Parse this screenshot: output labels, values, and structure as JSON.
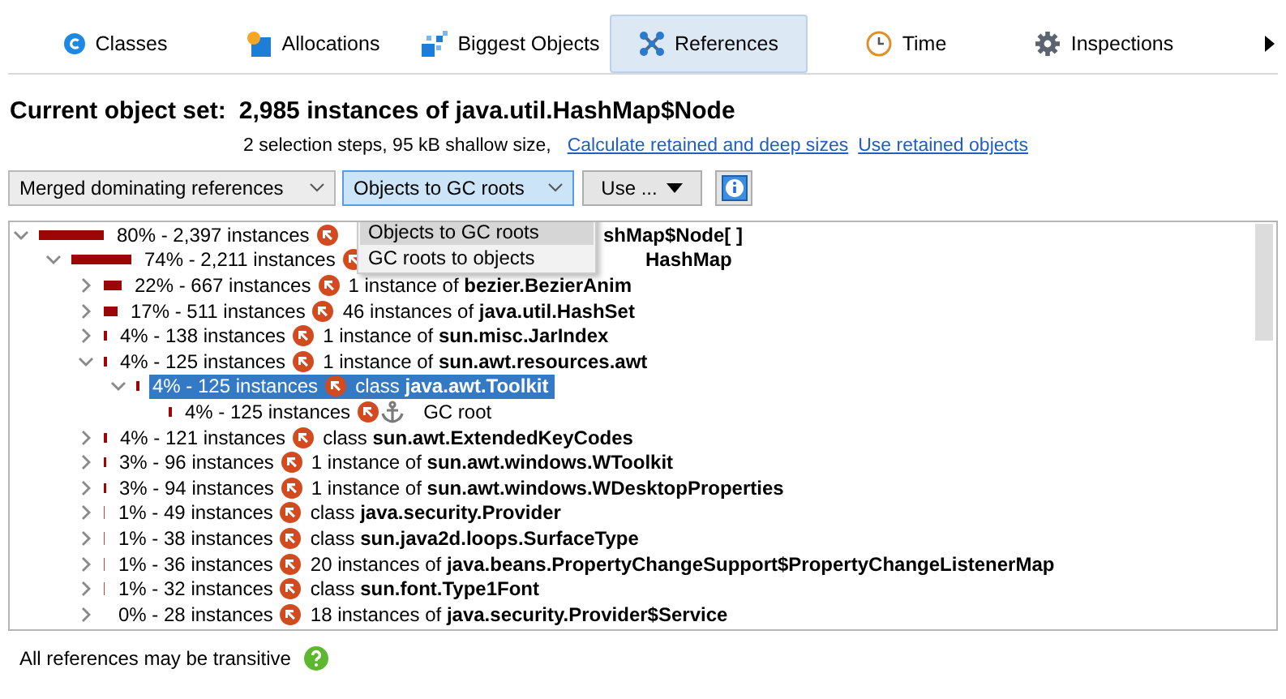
{
  "tabs": [
    {
      "label": "Classes",
      "selected": false
    },
    {
      "label": "Allocations",
      "selected": false
    },
    {
      "label": "Biggest Objects",
      "selected": false
    },
    {
      "label": "References",
      "selected": true
    },
    {
      "label": "Time",
      "selected": false
    },
    {
      "label": "Inspections",
      "selected": false
    }
  ],
  "heading": {
    "label": "Current object set:",
    "value": "2,985 instances of java.util.HashMap$Node"
  },
  "summary": {
    "text": "2 selection steps, 95 kB shallow size,",
    "links": [
      "Calculate retained and deep sizes",
      "Use retained objects"
    ]
  },
  "toolbar": {
    "view_select": "Merged dominating references",
    "direction_select": {
      "value": "Objects to GC roots",
      "expanded": true
    },
    "use_button": "Use ..."
  },
  "direction_menu": [
    {
      "label": "Objects to GC roots",
      "selected": true
    },
    {
      "label": "GC roots to objects",
      "selected": false
    }
  ],
  "tree": [
    {
      "label": "80% - 2,397 instances",
      "level": 0.8,
      "expanded": true,
      "covered": true,
      "selected": false,
      "description": "**shMap$Node[ ]**",
      "children": [
        {
          "label": "74% - 2,211 instances",
          "level": 0.74,
          "expanded": true,
          "covered": true,
          "selected": false,
          "description": "**HashMap**",
          "children": [
            {
              "label": "22% - 667 instances",
              "level": 0.22,
              "expanded": false,
              "selected": false,
              "description": "1 instance of **bezier.BezierAnim**"
            },
            {
              "label": "17% - 511 instances",
              "level": 0.17,
              "expanded": false,
              "selected": false,
              "description": "46 instances of **java.util.HashSet**"
            },
            {
              "label": "4% - 138 instances",
              "level": 0.04,
              "expanded": false,
              "selected": false,
              "description": "1 instance of **sun.misc.JarIndex**"
            },
            {
              "label": "4% - 125 instances",
              "level": 0.04,
              "expanded": true,
              "selected": false,
              "description": "1 instance of **sun.awt.resources.awt**",
              "children": [
                {
                  "label": "4% - 125 instances",
                  "level": 0.04,
                  "expanded": true,
                  "selected": true,
                  "description": "class **java.awt.Toolkit**",
                  "children": [
                    {
                      "label": "4% - 125 instances",
                      "level": 0.04,
                      "gc_root": true,
                      "selected": false,
                      "description": "GC root"
                    }
                  ]
                }
              ]
            },
            {
              "label": "4% - 121 instances",
              "level": 0.04,
              "expanded": false,
              "selected": false,
              "description": "class **sun.awt.ExtendedKeyCodes**"
            },
            {
              "label": "3% - 96 instances",
              "level": 0.03,
              "expanded": false,
              "selected": false,
              "description": "1 instance of **sun.awt.windows.WToolkit**"
            },
            {
              "label": "3% - 94 instances",
              "level": 0.03,
              "expanded": false,
              "selected": false,
              "description": "1 instance of **sun.awt.windows.WDesktopProperties**"
            },
            {
              "label": "1% - 49 instances",
              "level": 0.01,
              "expanded": false,
              "selected": false,
              "description": "class **java.security.Provider**"
            },
            {
              "label": "1% - 38 instances",
              "level": 0.01,
              "expanded": false,
              "selected": false,
              "description": "class **sun.java2d.loops.SurfaceType**"
            },
            {
              "label": "1% - 36 instances",
              "level": 0.01,
              "expanded": false,
              "selected": false,
              "description": "20 instances of **java.beans.PropertyChangeSupport$PropertyChangeListenerMap**"
            },
            {
              "label": "1% - 32 instances",
              "level": 0.01,
              "expanded": false,
              "selected": false,
              "description": "class **sun.font.Type1Font**"
            },
            {
              "label": "0% - 28 instances",
              "expanded": false,
              "selected": false,
              "description": "18 instances of **java.security.Provider$Service**"
            }
          ]
        }
      ]
    }
  ],
  "status": "All references may be transitive"
}
